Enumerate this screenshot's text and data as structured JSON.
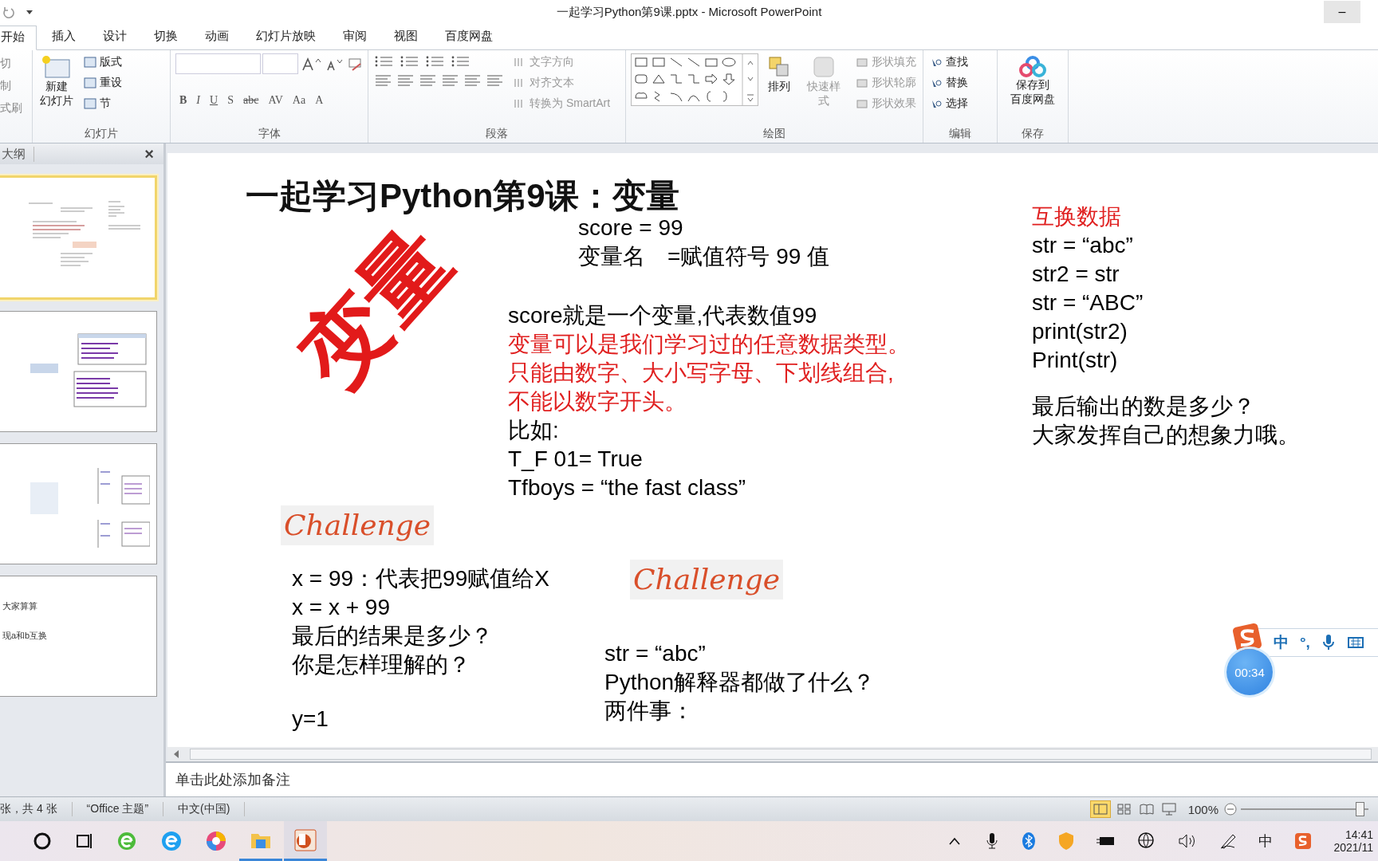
{
  "window": {
    "title": "一起学习Python第9课.pptx - Microsoft PowerPoint",
    "minimize": "–"
  },
  "ribbon_tabs": [
    {
      "label": "开始",
      "selected": true
    },
    {
      "label": "插入",
      "selected": false
    },
    {
      "label": "设计",
      "selected": false
    },
    {
      "label": "切换",
      "selected": false
    },
    {
      "label": "动画",
      "selected": false
    },
    {
      "label": "幻灯片放映",
      "selected": false
    },
    {
      "label": "审阅",
      "selected": false
    },
    {
      "label": "视图",
      "selected": false
    },
    {
      "label": "百度网盘",
      "selected": false
    }
  ],
  "ribbon": {
    "clipboard": [
      "切",
      "制",
      "式刷"
    ],
    "slides": {
      "new_slide": [
        "新建",
        "幻灯片"
      ],
      "items": [
        "版式",
        "重设",
        "节"
      ],
      "label": "幻灯片"
    },
    "font": {
      "buttons": [
        "B",
        "I",
        "U",
        "S",
        "abc",
        "AV",
        "Aa",
        "A"
      ],
      "label": "字体"
    },
    "paragraph": {
      "items": [
        "文字方向",
        "对齐文本",
        "转换为 SmartArt"
      ],
      "label": "段落"
    },
    "drawing": {
      "arrange": "排列",
      "quick_styles": "快速样式",
      "items": [
        "形状填充",
        "形状轮廓",
        "形状效果"
      ],
      "label": "绘图"
    },
    "editing": {
      "items": [
        "查找",
        "替换",
        "选择"
      ],
      "label": "编辑"
    },
    "save": {
      "lines": [
        "保存到",
        "百度网盘"
      ],
      "label": "保存"
    }
  },
  "slide_pane": {
    "tab": "大纲",
    "close": "×",
    "thumbnails": [
      {
        "selected": true
      },
      {
        "selected": false
      },
      {
        "selected": false
      },
      {
        "selected": false,
        "lines": [
          "大家算算",
          "现a和b互换"
        ]
      }
    ]
  },
  "slide": {
    "title": "一起学习Python第9课：变量",
    "big_word": "变量",
    "text_boxes": [
      {
        "lines": [
          {
            "text": "score = 99",
            "color": "#000000"
          },
          {
            "text": "变量名　=赋值符号   99 值",
            "color": "#000000"
          }
        ]
      },
      {
        "lines": [
          {
            "text": "score就是一个变量,代表数值99",
            "color": "#000000"
          },
          {
            "text": "变量可以是我们学习过的任意数据类型。",
            "color": "#e02020"
          },
          {
            "text": "只能由数字、大小写字母、下划线组合,",
            "color": "#e02020"
          },
          {
            "text": "不能以数字开头。",
            "color": "#e02020"
          },
          {
            "text": "比如:",
            "color": "#000000"
          },
          {
            "text": "T_F 01= True",
            "color": "#000000"
          },
          {
            "text": "Tfboys = “the fast class”",
            "color": "#000000"
          }
        ]
      },
      {
        "lines": [
          {
            "text": "互换数据",
            "color": "#e02020"
          },
          {
            "text": "str = “abc”",
            "color": "#000000"
          },
          {
            "text": "str2 = str",
            "color": "#000000"
          },
          {
            "text": "str = “ABC”",
            "color": "#000000"
          },
          {
            "text": "print(str2)",
            "color": "#000000"
          },
          {
            "text": "Print(str)",
            "color": "#000000"
          }
        ]
      },
      {
        "lines": [
          {
            "text": "最后输出的数是多少？",
            "color": "#000000"
          },
          {
            "text": "大家发挥自己的想象力哦。",
            "color": "#000000"
          }
        ]
      },
      {
        "lines": [
          {
            "text": "x = 99：代表把99赋值给X",
            "color": "#000000"
          },
          {
            "text": "x = x + 99",
            "color": "#000000"
          },
          {
            "text": "最后的结果是多少？",
            "color": "#000000"
          },
          {
            "text": "你是怎样理解的？",
            "color": "#000000"
          }
        ]
      },
      {
        "lines": [
          {
            "text": "y=1",
            "color": "#000000"
          }
        ]
      },
      {
        "lines": [
          {
            "text": "str = “abc”",
            "color": "#000000"
          },
          {
            "text": "Python解释器都做了什么？",
            "color": "#000000"
          },
          {
            "text": "两件事：",
            "color": "#000000"
          }
        ]
      }
    ],
    "badges": [
      "Challenge",
      "Challenge"
    ]
  },
  "notes": {
    "placeholder": "单击此处添加备注"
  },
  "status_bar": {
    "slide_info": "张，共 4 张",
    "theme": "“Office 主题”",
    "language": "中文(中国)",
    "zoom": "100%",
    "zoom_level": {
      "level": 0.93
    }
  },
  "recorder": {
    "time": "00:34"
  },
  "ime_bar": {
    "mode": "中",
    "punct": "°,"
  },
  "taskbar": {
    "tray_ime": "中",
    "time": "14:41",
    "date": "2021/11"
  }
}
